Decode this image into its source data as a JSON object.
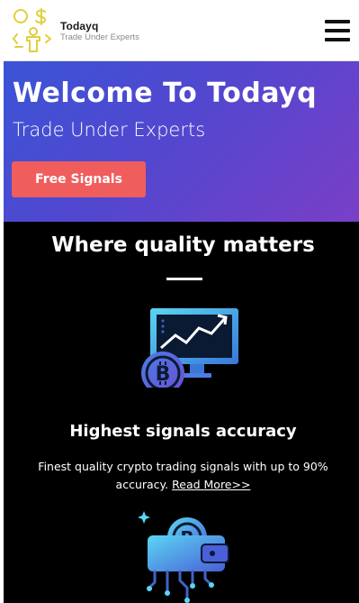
{
  "header": {
    "brand_name": "Todayq",
    "brand_tagline": "Trade Under Experts",
    "logo_icon": "money-person-icon",
    "menu_icon": "hamburger-menu-icon"
  },
  "hero": {
    "title": "Welcome To Todayq",
    "subtitle": "Trade Under Experts",
    "cta_label": "Free Signals"
  },
  "features_section": {
    "title": "Where quality matters",
    "feature": {
      "icon": "bitcoin-chart-monitor-icon",
      "title": "Highest signals accuracy",
      "description": "Finest quality crypto trading signals with up to 90% accuracy.",
      "link_label": "Read More>>"
    },
    "next_feature_icon": "bitcoin-wallet-circuit-icon"
  },
  "colors": {
    "hero_gradient_start": "#3a54d6",
    "hero_gradient_end": "#7a3fc7",
    "cta": "#f05d5d",
    "section_bg": "#000000",
    "logo_accent": "#e8d84a"
  }
}
